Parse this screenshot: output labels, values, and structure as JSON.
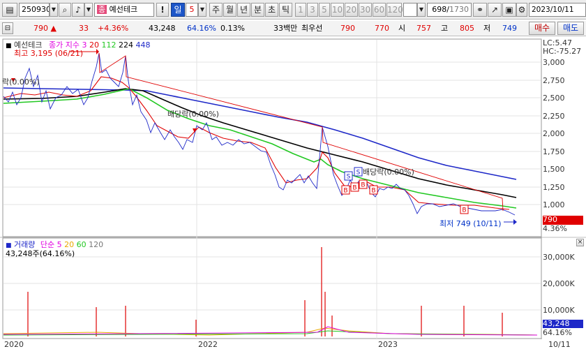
{
  "toolbar": {
    "code": "250930",
    "name": "예선테크",
    "periods": [
      "일",
      "5",
      "주",
      "월",
      "년",
      "분",
      "초",
      "틱"
    ],
    "minute_steps": [
      "1",
      "3",
      "5",
      "10",
      "20",
      "30",
      "60",
      "120"
    ],
    "position": "698",
    "total": "1730",
    "date": "2023/10/11"
  },
  "quote": {
    "price": "790",
    "change": "33",
    "change_pct": "+4.36%",
    "volume": "43,248",
    "turnover_pct": "64.16%",
    "ratio": "0.13%",
    "high_label": "33백만",
    "pref_label": "최우선",
    "ask": "790",
    "bid": "770",
    "open_label": "시",
    "open": "757",
    "high_label2": "고",
    "high": "805",
    "low_label": "저",
    "low": "749",
    "buy_label": "매수",
    "sell_label": "매도"
  },
  "price_panel": {
    "legend_name": "예선테크",
    "legend_price": "종가 지수 3",
    "ma": [
      "20",
      "112",
      "224",
      "448"
    ],
    "max_label": "최고 3,195 (06/21)",
    "min_label": "최저 749 (10/11)",
    "div1": "배당락(0.00%)",
    "div2": "배당락(0.00%)",
    "div3": "락(0.00%)",
    "lc": "LC:5.47",
    "hc": "HC:-75.27",
    "last_price": "790",
    "last_pct": "4.36%",
    "markers": [
      "S",
      "S",
      "B",
      "B",
      "B",
      "B",
      "B"
    ]
  },
  "volume_panel": {
    "legend_name": "거래량",
    "legend_ma": "단순 5",
    "ma": [
      "20",
      "60",
      "120"
    ],
    "detail": "43,248주(64.16%)",
    "last_volume": "43,248",
    "last_pct": "64.16%"
  },
  "axis": {
    "price_ticks": [
      "3,000",
      "2,750",
      "2,500",
      "2,250",
      "2,000",
      "1,750",
      "1,500",
      "1,250",
      "1,000"
    ],
    "volume_ticks": [
      "30,000K",
      "20,000K",
      "10,000K"
    ],
    "dates": [
      "2020",
      "2022",
      "2023"
    ],
    "last_date": "10/11"
  },
  "colors": {
    "up": "#e00000",
    "down": "#0032c8",
    "ma20": "#e00000",
    "ma112": "#22c822",
    "ma224": "#000000",
    "ma448": "#1e28c8"
  }
}
